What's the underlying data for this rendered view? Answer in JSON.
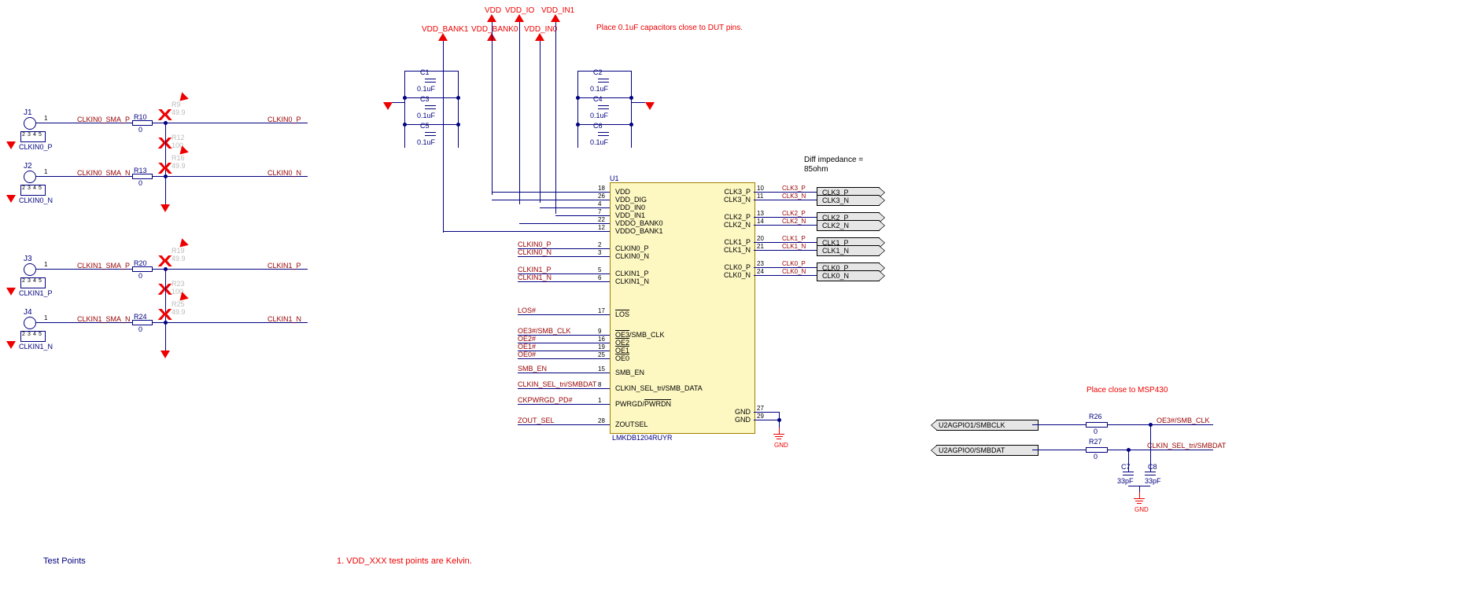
{
  "notes": {
    "cap_note": "Place 0.1uF capacitors close to DUT pins.",
    "diff_imp1": "Diff impedance =",
    "diff_imp2": "85ohm",
    "msp_note": "Place close to MSP430",
    "tp_heading": "Test Points",
    "kelvin_note": "1. VDD_XXX test points are Kelvin."
  },
  "power": {
    "vdd": "VDD",
    "vdd_io": "VDD_IO",
    "vdd_in1": "VDD_IN1",
    "vdd_bank1": "VDD_BANK1",
    "vdd_bank0": "VDD_BANK0",
    "vdd_in0": "VDD_IN0",
    "gnd": "GND"
  },
  "caps": {
    "c1": "C1",
    "c2": "C2",
    "c3": "C3",
    "c4": "C4",
    "c5": "C5",
    "c6": "C6",
    "c7": "C7",
    "c8": "C8",
    "val": "0.1uF",
    "val33": "33pF"
  },
  "res": {
    "r9": "R9",
    "r10": "R10",
    "r12": "R12",
    "r13": "R13",
    "r16": "R16",
    "r19": "R19",
    "r20": "R20",
    "r23": "R23",
    "r24": "R24",
    "r25": "R25",
    "r26": "R26",
    "r27": "R27",
    "v0": "0",
    "v49": "49.9",
    "v100": "100"
  },
  "conns": {
    "j1": "J1",
    "j2": "J2",
    "j3": "J3",
    "j4": "J4",
    "j1n": "CLKIN0_P",
    "j2n": "CLKIN0_N",
    "j3n": "CLKIN1_P",
    "j4n": "CLKIN1_N",
    "pins": "1",
    "gpins": [
      "2",
      "3",
      "4",
      "5"
    ]
  },
  "ic": {
    "ref": "U1",
    "part": "LMKDB1204RUYR",
    "left_pins": [
      {
        "num": "18",
        "name": "VDD"
      },
      {
        "num": "26",
        "name": "VDD_DIG"
      },
      {
        "num": "4",
        "name": "VDD_IN0"
      },
      {
        "num": "7",
        "name": "VDD_IN1"
      },
      {
        "num": "22",
        "name": "VDDO_BANK0"
      },
      {
        "num": "12",
        "name": "VDDO_BANK1"
      },
      {
        "num": "2",
        "name": "CLKIN0_P"
      },
      {
        "num": "3",
        "name": "CLKIN0_N"
      },
      {
        "num": "5",
        "name": "CLKIN1_P"
      },
      {
        "num": "6",
        "name": "CLKIN1_N"
      },
      {
        "num": "17",
        "name": "LOS",
        "bar": true
      },
      {
        "num": "9",
        "name": "OE3/SMB_CLK",
        "bar": "OE3"
      },
      {
        "num": "16",
        "name": "OE2",
        "bar": true
      },
      {
        "num": "19",
        "name": "OE1",
        "bar": true
      },
      {
        "num": "25",
        "name": "OE0",
        "bar": true
      },
      {
        "num": "15",
        "name": "SMB_EN"
      },
      {
        "num": "8",
        "name": "CLKIN_SEL_tri/SMB_DATA"
      },
      {
        "num": "1",
        "name": "PWRGD/PWRDN",
        "bar": "PWRDN"
      },
      {
        "num": "28",
        "name": "ZOUTSEL"
      }
    ],
    "right_pins": [
      {
        "num": "10",
        "name": "CLK3_P"
      },
      {
        "num": "11",
        "name": "CLK3_N"
      },
      {
        "num": "13",
        "name": "CLK2_P"
      },
      {
        "num": "14",
        "name": "CLK2_N"
      },
      {
        "num": "20",
        "name": "CLK1_P"
      },
      {
        "num": "21",
        "name": "CLK1_N"
      },
      {
        "num": "23",
        "name": "CLK0_P"
      },
      {
        "num": "24",
        "name": "CLK0_N"
      },
      {
        "num": "27",
        "name": "GND"
      },
      {
        "num": "29",
        "name": "GND"
      }
    ]
  },
  "nets": {
    "clkin0_sma_p": "CLKIN0_SMA_P",
    "clkin0_sma_n": "CLKIN0_SMA_N",
    "clkin1_sma_p": "CLKIN1_SMA_P",
    "clkin1_sma_n": "CLKIN1_SMA_N",
    "clkin0_p": "CLKIN0_P",
    "clkin0_n": "CLKIN0_N",
    "clkin1_p": "CLKIN1_P",
    "clkin1_n": "CLKIN1_N",
    "los": "LOS#",
    "oe3": "OE3#/SMB_CLK",
    "oe2": "OE2#",
    "oe1": "OE1#",
    "oe0": "OE0#",
    "smb_en": "SMB_EN",
    "clkin_sel": "CLKIN_SEL_tri/SMBDAT",
    "pwrgd": "CKPWRGD_PD#",
    "zout": "ZOUT_SEL",
    "clk3p": "CLK3_P",
    "clk3n": "CLK3_N",
    "clk2p": "CLK2_P",
    "clk2n": "CLK2_N",
    "clk1p": "CLK1_P",
    "clk1n": "CLK1_N",
    "clk0p": "CLK0_P",
    "clk0n": "CLK0_N",
    "u2a1": "U2AGPIO1/SMBCLK",
    "u2a0": "U2AGPIO0/SMBDAT"
  }
}
